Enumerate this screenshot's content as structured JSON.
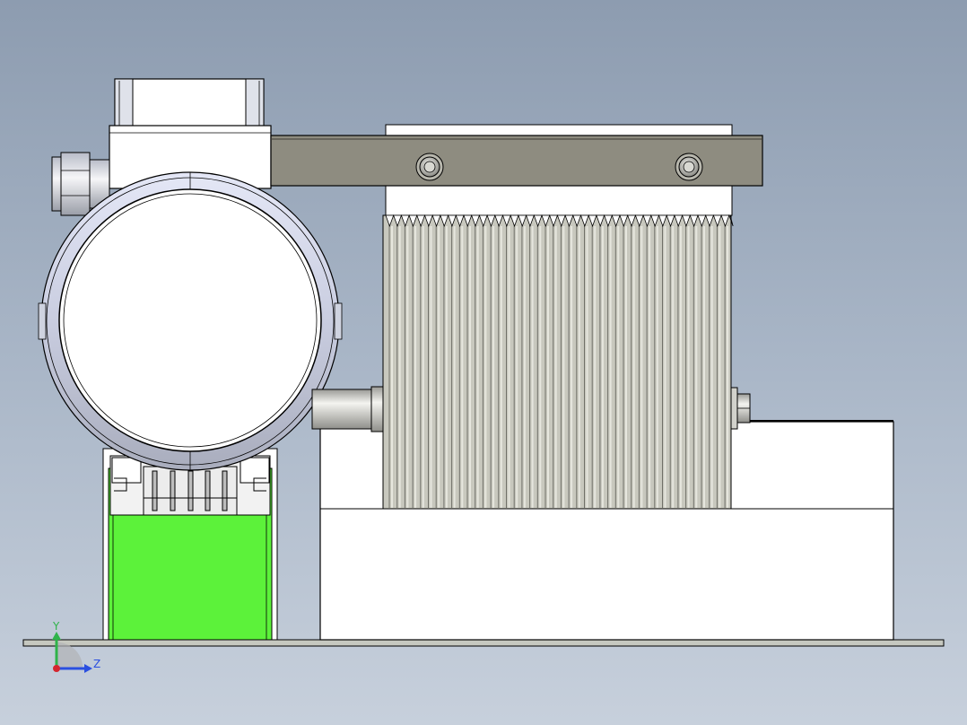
{
  "view": {
    "background_top": "#8d9cb0",
    "background_bottom": "#c7d0dc",
    "part_outline": "#000000",
    "highlight_green": "#5cf23a",
    "bracket_gray": "#8e8c80"
  },
  "triad": {
    "y_label": "Y",
    "z_label": "Z",
    "y_color": "#2fb34a",
    "z_color": "#2a4fe0",
    "origin_color": "#d4262e"
  }
}
